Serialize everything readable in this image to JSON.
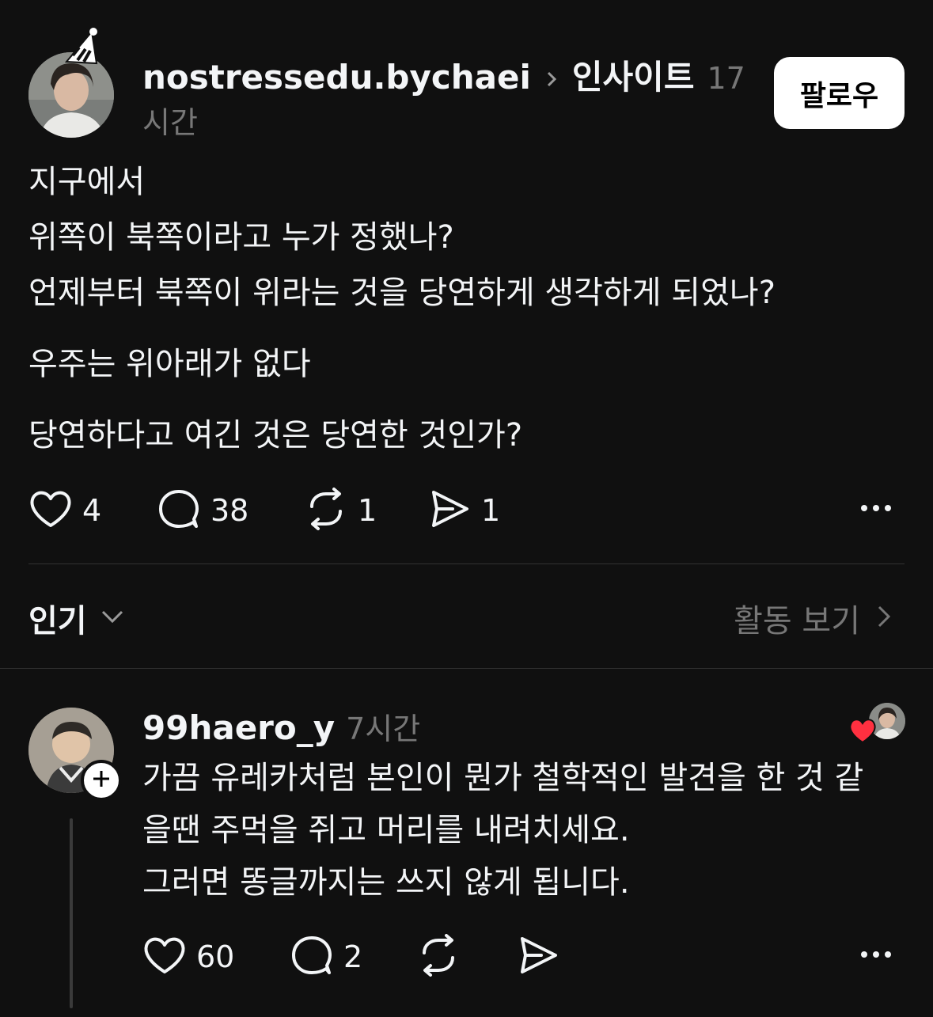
{
  "post": {
    "author": "nostressedu.bychaei",
    "community": "인사이트",
    "time": "17",
    "time_unit": "시간",
    "follow_label": "팔로우",
    "lines": [
      "지구에서",
      "위쪽이 북쪽이라고 누가 정했나?",
      "언제부터 북쪽이 위라는 것을 당연하게 생각하게 되었나?",
      "우주는 위아래가 없다",
      "당연하다고 여긴 것은 당연한 것인가?"
    ],
    "likes": "4",
    "comments": "38",
    "reposts": "1",
    "shares": "1"
  },
  "sort": {
    "label": "인기",
    "activity_label": "활동 보기"
  },
  "reply": {
    "author": "99haero_y",
    "time": "7시간",
    "lines": [
      "가끔 유레카처럼 본인이 뭔가 철학적인 발견을 한 것 같",
      "을땐 주먹을 쥐고 머리를 내려치세요.",
      "그러면 똥글까지는 쓰지 않게 됩니다."
    ],
    "likes": "60",
    "comments": "2"
  },
  "icons": {
    "heart": "heart-icon",
    "comment": "comment-icon",
    "repost": "repost-icon",
    "share": "share-icon",
    "more": "more-icon",
    "chevron_down": "chevron-down-icon",
    "chevron_right": "chevron-right-icon",
    "add": "add-icon"
  },
  "colors": {
    "background": "#101010",
    "text": "#f3f5f7",
    "muted": "#777777",
    "liked": "#ff3040"
  }
}
